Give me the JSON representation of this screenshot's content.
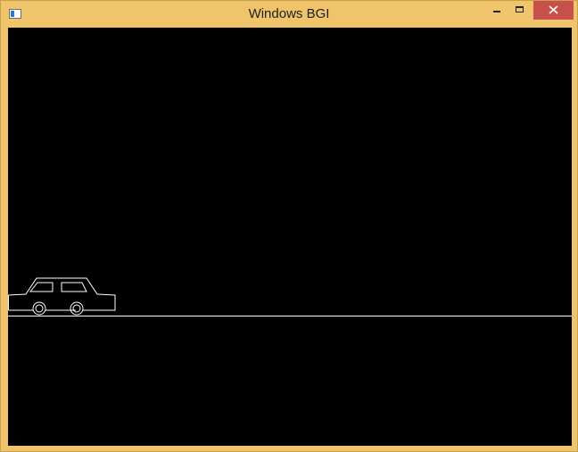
{
  "window": {
    "title": "Windows BGI",
    "controls": {
      "minimize": "minimize",
      "maximize": "maximize",
      "close": "close"
    },
    "colors": {
      "frame": "#f0c46a",
      "close_button": "#c7504b",
      "canvas_background": "#000000",
      "drawing_stroke": "#ffffff"
    }
  },
  "canvas": {
    "scene": [
      "ground-line",
      "car"
    ]
  }
}
